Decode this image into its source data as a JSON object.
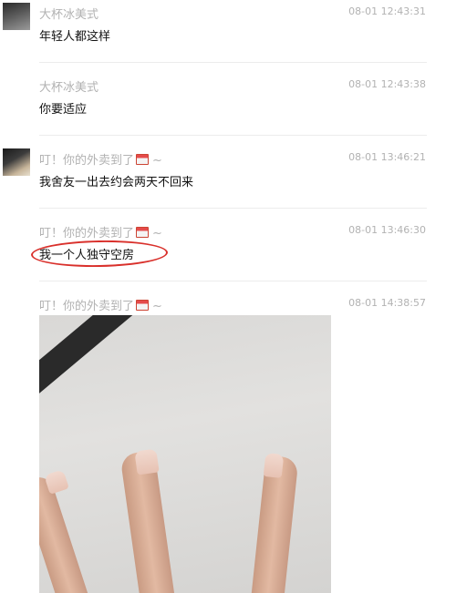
{
  "messages": [
    {
      "sender": "大杯冰美式",
      "time": "08-01 12:43:31",
      "text": "年轻人都这样"
    },
    {
      "sender": "大杯冰美式",
      "time": "08-01 12:43:38",
      "text": "你要适应"
    },
    {
      "sender": "叮！你的外卖到了",
      "time": "08-01 13:46:21",
      "text": "我舍友一出去约会两天不回来"
    },
    {
      "sender": "叮！你的外卖到了",
      "time": "08-01 13:46:30",
      "text": "我一个人独守空房"
    },
    {
      "sender": "叮！你的外卖到了",
      "time": "08-01 14:38:57",
      "text": ""
    }
  ],
  "sender_suffix": "~",
  "annotation": {
    "color": "#d9302b"
  }
}
